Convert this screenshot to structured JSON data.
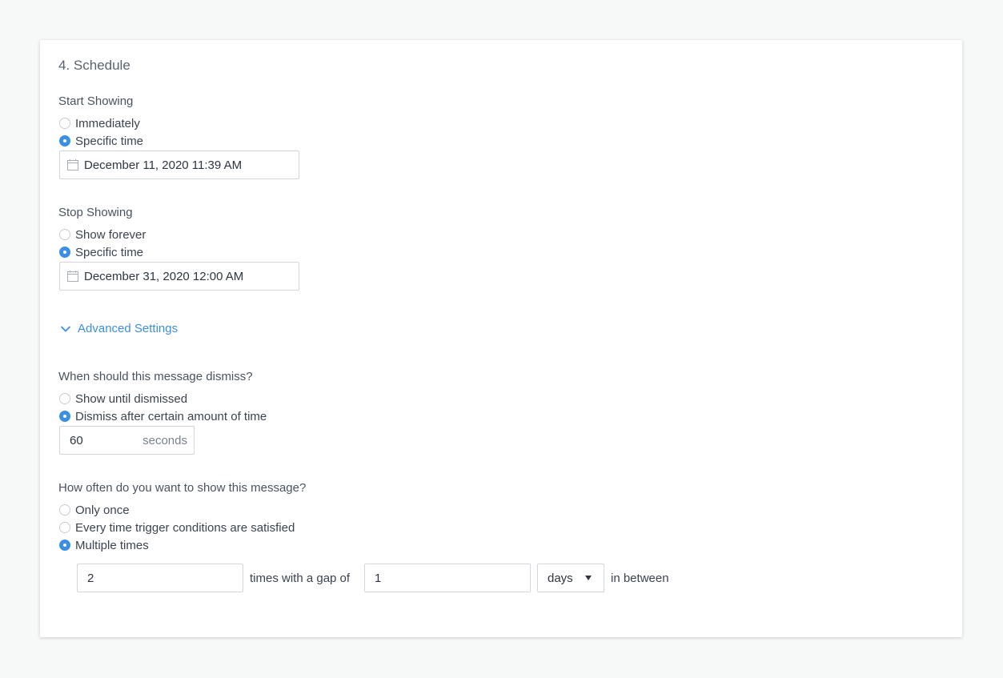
{
  "section_title": "4. Schedule",
  "start": {
    "label": "Start Showing",
    "options": [
      "Immediately",
      "Specific time"
    ],
    "selected": "Specific time",
    "datetime": "December 11, 2020 11:39 AM"
  },
  "stop": {
    "label": "Stop Showing",
    "options": [
      "Show forever",
      "Specific time"
    ],
    "selected": "Specific time",
    "datetime": "December 31, 2020 12:00 AM"
  },
  "advanced": {
    "label": "Advanced Settings"
  },
  "dismiss": {
    "label": "When should this message dismiss?",
    "options": [
      "Show until dismissed",
      "Dismiss after certain amount of time"
    ],
    "selected": "Dismiss after certain amount of time",
    "value": "60",
    "unit": "seconds"
  },
  "frequency": {
    "label": "How often do you want to show this message?",
    "options": [
      "Only once",
      "Every time trigger conditions are satisfied",
      "Multiple times"
    ],
    "selected": "Multiple times",
    "times_value": "2",
    "times_label": "times with a gap of",
    "gap_value": "1",
    "gap_unit": "days",
    "suffix": "in between"
  },
  "colors": {
    "accent": "#3b8fe4",
    "background": "#f7f8f8",
    "card": "#ffffff"
  }
}
